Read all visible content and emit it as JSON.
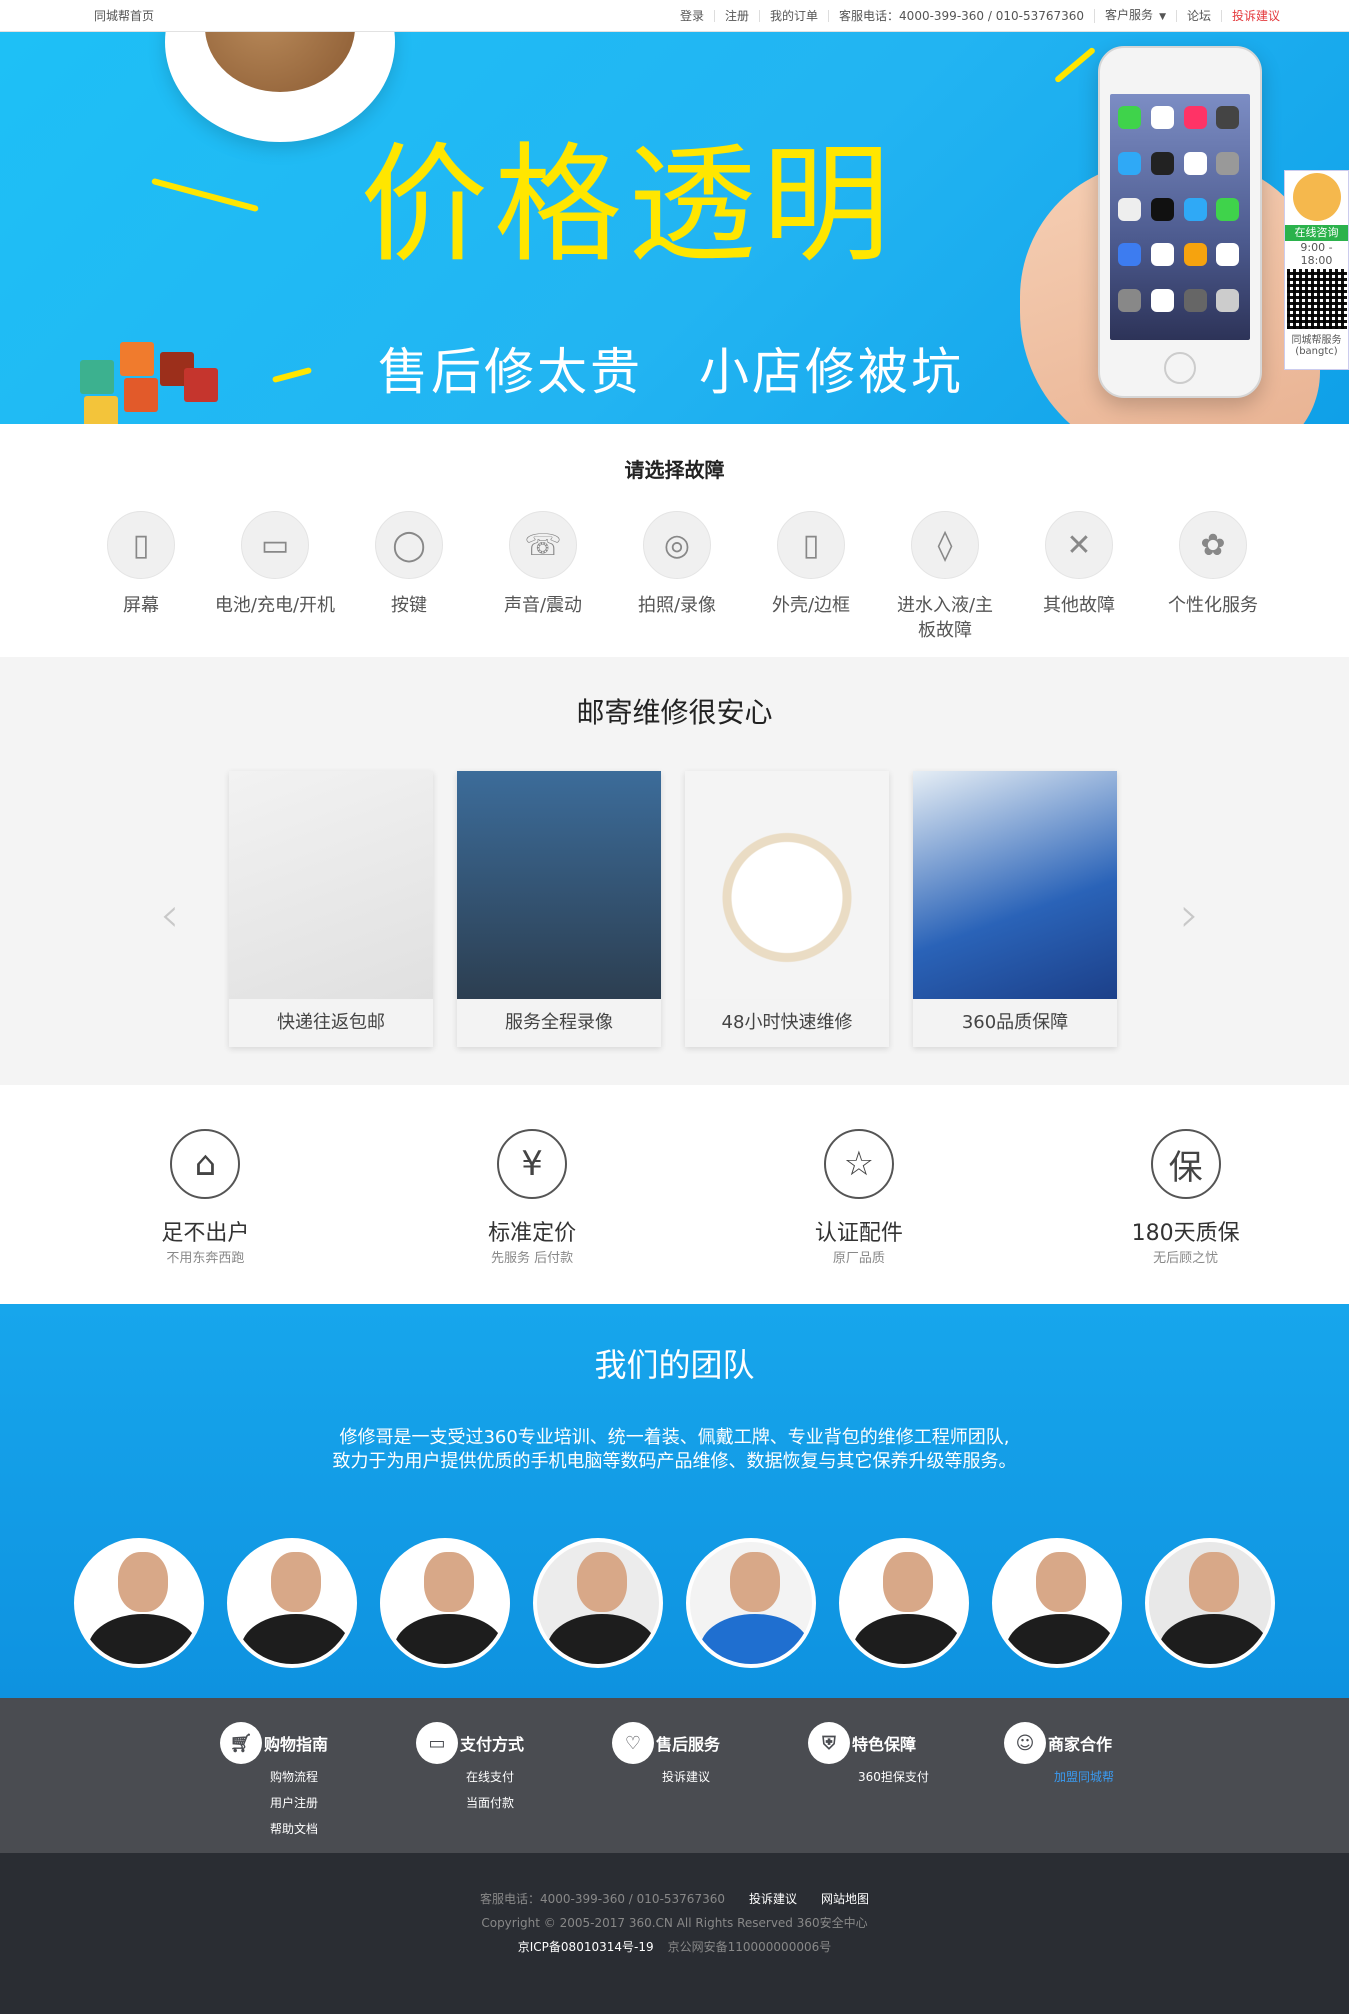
{
  "topbar": {
    "home": "同城帮首页",
    "links": [
      "登录",
      "注册",
      "我的订单",
      "客服电话：4000-399-360 / 010-53767360",
      "客户服务",
      "论坛",
      "投诉建议"
    ]
  },
  "banner": {
    "headline": "价格透明",
    "sub1": "售后修太贵",
    "sub2": "小店修被坑",
    "consult": {
      "tag": "在线咨询",
      "hours": "9:00 - 18:00",
      "note": "同城帮服务(bangtc)"
    }
  },
  "faults": {
    "title": "请选择故障",
    "items": [
      {
        "label": "屏幕",
        "icon": "phone-screen-icon"
      },
      {
        "label": "电池/充电/开机",
        "icon": "battery-icon"
      },
      {
        "label": "按键",
        "icon": "power-button-icon"
      },
      {
        "label": "声音/震动",
        "icon": "phone-call-icon"
      },
      {
        "label": "拍照/录像",
        "icon": "camera-icon"
      },
      {
        "label": "外壳/边框",
        "icon": "phone-frame-icon"
      },
      {
        "label": "进水入液/主板故障",
        "icon": "water-drop-icon"
      },
      {
        "label": "其他故障",
        "icon": "tools-icon"
      },
      {
        "label": "个性化服务",
        "icon": "palette-icon"
      }
    ]
  },
  "mail": {
    "title": "邮寄维修很安心",
    "cards": [
      "快递往返包邮",
      "服务全程录像",
      "48小时快速维修",
      "360品质保障"
    ]
  },
  "features": [
    {
      "title": "足不出户",
      "sub": "不用东奔西跑",
      "icon": "house-icon"
    },
    {
      "title": "标准定价",
      "sub": "先服务 后付款",
      "icon": "yuan-icon"
    },
    {
      "title": "认证配件",
      "sub": "原厂品质",
      "icon": "star-icon"
    },
    {
      "title": "180天质保",
      "sub": "无后顾之忧",
      "icon": "guarantee-icon"
    }
  ],
  "team": {
    "title": "我们的团队",
    "p1": "修修哥是一支受过360专业培训、统一着装、佩戴工牌、专业背包的维修工程师团队,",
    "p2": "致力于为用户提供优质的手机电脑等数码产品维修、数据恢复与其它保养升级等服务。"
  },
  "footer": {
    "cols": [
      {
        "title": "购物指南",
        "icon": "cart-icon",
        "links": [
          "购物流程",
          "用户注册",
          "帮助文档"
        ]
      },
      {
        "title": "支付方式",
        "icon": "card-icon",
        "links": [
          "在线支付",
          "当面付款"
        ]
      },
      {
        "title": "售后服务",
        "icon": "heart-icon",
        "links": [
          "投诉建议"
        ]
      },
      {
        "title": "特色保障",
        "icon": "shield-icon",
        "links": [
          "360担保支付"
        ]
      },
      {
        "title": "商家合作",
        "icon": "partners-icon",
        "links": [
          "加盟同城帮"
        ]
      }
    ],
    "line1": "客服电话：4000-399-360 / 010-53767360",
    "line1_links": [
      "投诉建议",
      "网站地图"
    ],
    "line2": "Copyright © 2005-2017  360.CN  All Rights Reserved  360安全中心",
    "line3a": "京ICP备08010314号-19",
    "line3b": "京公网安备110000000006号"
  }
}
